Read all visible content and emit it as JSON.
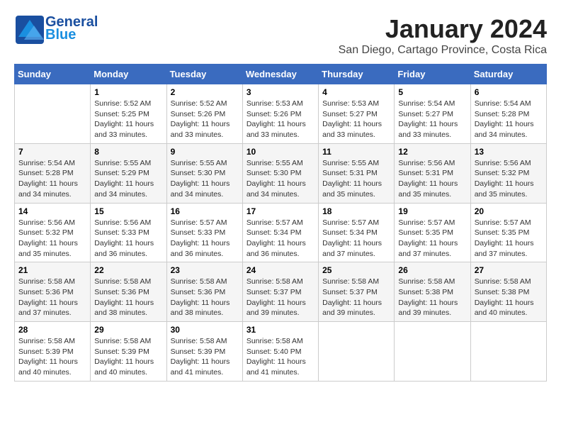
{
  "logo": {
    "line1": "General",
    "line2": "Blue"
  },
  "title": "January 2024",
  "subtitle": "San Diego, Cartago Province, Costa Rica",
  "days_of_week": [
    "Sunday",
    "Monday",
    "Tuesday",
    "Wednesday",
    "Thursday",
    "Friday",
    "Saturday"
  ],
  "weeks": [
    [
      {
        "day": "",
        "info": ""
      },
      {
        "day": "1",
        "info": "Sunrise: 5:52 AM\nSunset: 5:25 PM\nDaylight: 11 hours\nand 33 minutes."
      },
      {
        "day": "2",
        "info": "Sunrise: 5:52 AM\nSunset: 5:26 PM\nDaylight: 11 hours\nand 33 minutes."
      },
      {
        "day": "3",
        "info": "Sunrise: 5:53 AM\nSunset: 5:26 PM\nDaylight: 11 hours\nand 33 minutes."
      },
      {
        "day": "4",
        "info": "Sunrise: 5:53 AM\nSunset: 5:27 PM\nDaylight: 11 hours\nand 33 minutes."
      },
      {
        "day": "5",
        "info": "Sunrise: 5:54 AM\nSunset: 5:27 PM\nDaylight: 11 hours\nand 33 minutes."
      },
      {
        "day": "6",
        "info": "Sunrise: 5:54 AM\nSunset: 5:28 PM\nDaylight: 11 hours\nand 34 minutes."
      }
    ],
    [
      {
        "day": "7",
        "info": "Sunrise: 5:54 AM\nSunset: 5:28 PM\nDaylight: 11 hours\nand 34 minutes."
      },
      {
        "day": "8",
        "info": "Sunrise: 5:55 AM\nSunset: 5:29 PM\nDaylight: 11 hours\nand 34 minutes."
      },
      {
        "day": "9",
        "info": "Sunrise: 5:55 AM\nSunset: 5:30 PM\nDaylight: 11 hours\nand 34 minutes."
      },
      {
        "day": "10",
        "info": "Sunrise: 5:55 AM\nSunset: 5:30 PM\nDaylight: 11 hours\nand 34 minutes."
      },
      {
        "day": "11",
        "info": "Sunrise: 5:55 AM\nSunset: 5:31 PM\nDaylight: 11 hours\nand 35 minutes."
      },
      {
        "day": "12",
        "info": "Sunrise: 5:56 AM\nSunset: 5:31 PM\nDaylight: 11 hours\nand 35 minutes."
      },
      {
        "day": "13",
        "info": "Sunrise: 5:56 AM\nSunset: 5:32 PM\nDaylight: 11 hours\nand 35 minutes."
      }
    ],
    [
      {
        "day": "14",
        "info": "Sunrise: 5:56 AM\nSunset: 5:32 PM\nDaylight: 11 hours\nand 35 minutes."
      },
      {
        "day": "15",
        "info": "Sunrise: 5:56 AM\nSunset: 5:33 PM\nDaylight: 11 hours\nand 36 minutes."
      },
      {
        "day": "16",
        "info": "Sunrise: 5:57 AM\nSunset: 5:33 PM\nDaylight: 11 hours\nand 36 minutes."
      },
      {
        "day": "17",
        "info": "Sunrise: 5:57 AM\nSunset: 5:34 PM\nDaylight: 11 hours\nand 36 minutes."
      },
      {
        "day": "18",
        "info": "Sunrise: 5:57 AM\nSunset: 5:34 PM\nDaylight: 11 hours\nand 37 minutes."
      },
      {
        "day": "19",
        "info": "Sunrise: 5:57 AM\nSunset: 5:35 PM\nDaylight: 11 hours\nand 37 minutes."
      },
      {
        "day": "20",
        "info": "Sunrise: 5:57 AM\nSunset: 5:35 PM\nDaylight: 11 hours\nand 37 minutes."
      }
    ],
    [
      {
        "day": "21",
        "info": "Sunrise: 5:58 AM\nSunset: 5:36 PM\nDaylight: 11 hours\nand 37 minutes."
      },
      {
        "day": "22",
        "info": "Sunrise: 5:58 AM\nSunset: 5:36 PM\nDaylight: 11 hours\nand 38 minutes."
      },
      {
        "day": "23",
        "info": "Sunrise: 5:58 AM\nSunset: 5:36 PM\nDaylight: 11 hours\nand 38 minutes."
      },
      {
        "day": "24",
        "info": "Sunrise: 5:58 AM\nSunset: 5:37 PM\nDaylight: 11 hours\nand 39 minutes."
      },
      {
        "day": "25",
        "info": "Sunrise: 5:58 AM\nSunset: 5:37 PM\nDaylight: 11 hours\nand 39 minutes."
      },
      {
        "day": "26",
        "info": "Sunrise: 5:58 AM\nSunset: 5:38 PM\nDaylight: 11 hours\nand 39 minutes."
      },
      {
        "day": "27",
        "info": "Sunrise: 5:58 AM\nSunset: 5:38 PM\nDaylight: 11 hours\nand 40 minutes."
      }
    ],
    [
      {
        "day": "28",
        "info": "Sunrise: 5:58 AM\nSunset: 5:39 PM\nDaylight: 11 hours\nand 40 minutes."
      },
      {
        "day": "29",
        "info": "Sunrise: 5:58 AM\nSunset: 5:39 PM\nDaylight: 11 hours\nand 40 minutes."
      },
      {
        "day": "30",
        "info": "Sunrise: 5:58 AM\nSunset: 5:39 PM\nDaylight: 11 hours\nand 41 minutes."
      },
      {
        "day": "31",
        "info": "Sunrise: 5:58 AM\nSunset: 5:40 PM\nDaylight: 11 hours\nand 41 minutes."
      },
      {
        "day": "",
        "info": ""
      },
      {
        "day": "",
        "info": ""
      },
      {
        "day": "",
        "info": ""
      }
    ]
  ]
}
